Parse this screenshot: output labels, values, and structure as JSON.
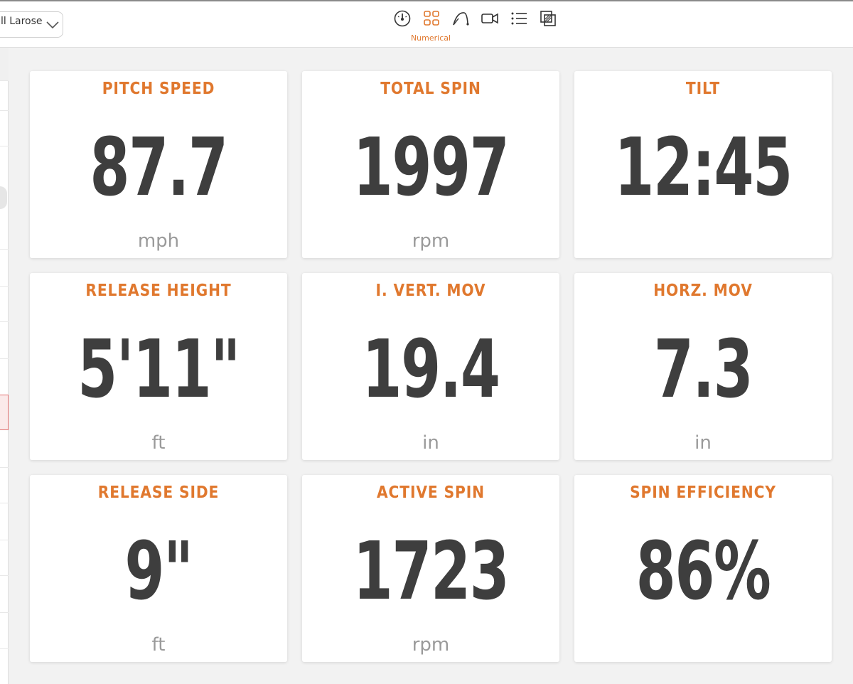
{
  "header": {
    "player_name": "ll Larose",
    "active_view_label": "Numerical",
    "views": [
      {
        "icon": "gauge-icon"
      },
      {
        "icon": "grid-icon"
      },
      {
        "icon": "trajectory-icon"
      },
      {
        "icon": "video-icon"
      },
      {
        "icon": "list-icon"
      },
      {
        "icon": "overlay-icon"
      }
    ]
  },
  "colors": {
    "accent": "#e0782e",
    "value": "#3e3e3e",
    "unit": "#9a9a9a"
  },
  "metrics": [
    {
      "title": "PITCH SPEED",
      "value": "87.7",
      "unit": "mph"
    },
    {
      "title": "TOTAL SPIN",
      "value": "1997",
      "unit": "rpm"
    },
    {
      "title": "TILT",
      "value": "12:45",
      "unit": ""
    },
    {
      "title": "RELEASE HEIGHT",
      "value": "5'11\"",
      "unit": "ft"
    },
    {
      "title": "I. VERT. MOV",
      "value": "19.4",
      "unit": "in"
    },
    {
      "title": "HORZ. MOV",
      "value": "7.3",
      "unit": "in"
    },
    {
      "title": "RELEASE SIDE",
      "value": "9\"",
      "unit": "ft"
    },
    {
      "title": "ACTIVE SPIN",
      "value": "1723",
      "unit": "rpm"
    },
    {
      "title": "SPIN EFFICIENCY",
      "value": "86%",
      "unit": ""
    }
  ]
}
